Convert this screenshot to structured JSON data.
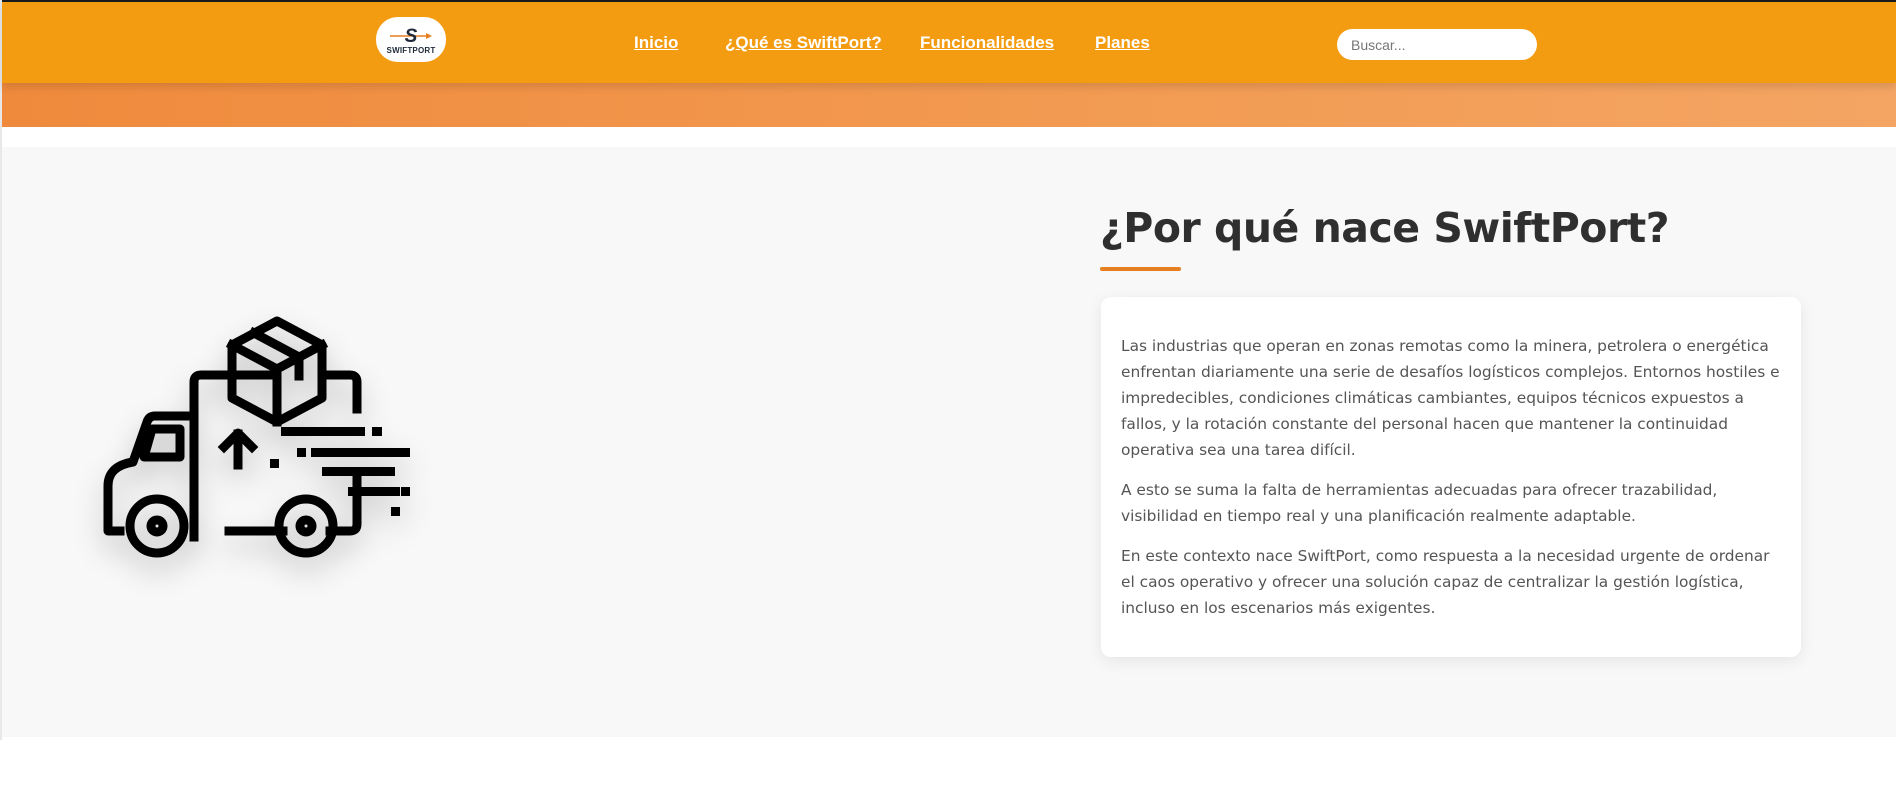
{
  "header": {
    "logo": {
      "text": "SWIFTPORT",
      "letter": "S"
    },
    "nav": [
      {
        "label": "Inicio"
      },
      {
        "label": "¿Qué es SwiftPort?"
      },
      {
        "label": "Funcionalidades"
      },
      {
        "label": "Planes"
      }
    ],
    "search": {
      "placeholder": "Buscar...",
      "value": ""
    }
  },
  "about": {
    "image_icon": "delivery-truck-icon",
    "title": "¿Por qué nace SwiftPort?",
    "paragraphs": [
      "Las industrias que operan en zonas remotas como la minera, petrolera o energética enfrentan diariamente una serie de desafíos logísticos complejos. Entornos hostiles e impredecibles, condiciones climáticas cambiantes, equipos técnicos expuestos a fallos, y la rotación constante del personal hacen que mantener la continuidad operativa sea una tarea difícil.",
      "A esto se suma la falta de herramientas adecuadas para ofrecer trazabilidad, visibilidad en tiempo real y una planificación realmente adaptable.",
      "En este contexto nace SwiftPort, como respuesta a la necesidad urgente de ordenar el caos operativo y ofrecer una solución capaz de centralizar la gestión logística, incluso en los escenarios más exigentes."
    ]
  },
  "colors": {
    "navbar": "#f39c12",
    "hero_band": "#ef8a3c",
    "accent_underline": "#e67e22",
    "section_bg": "#f8f8f8"
  }
}
